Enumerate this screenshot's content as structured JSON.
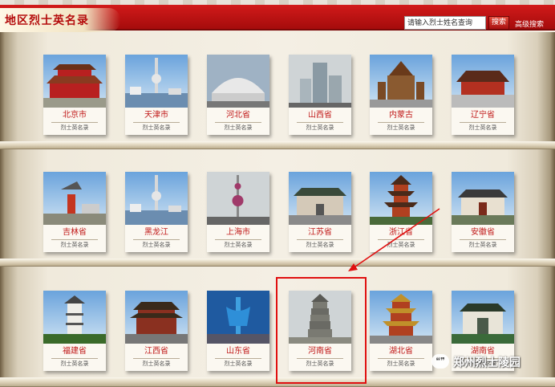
{
  "header": {
    "title": "地区烈士英名录",
    "search_placeholder": "请输入烈士姓名查询",
    "search_button": "搜索",
    "advanced_link": "高级搜索"
  },
  "card_subtitle": "烈士英名录",
  "shelves": [
    {
      "cards": [
        {
          "name": "北京市",
          "photo": "tiananmen"
        },
        {
          "name": "天津市",
          "photo": "tv-tower"
        },
        {
          "name": "河北省",
          "photo": "modern-building"
        },
        {
          "name": "山西省",
          "photo": "skyscraper"
        },
        {
          "name": "内蒙古",
          "photo": "domed-temple"
        },
        {
          "name": "辽宁省",
          "photo": "palace"
        }
      ]
    },
    {
      "cards": [
        {
          "name": "吉林省",
          "photo": "monument"
        },
        {
          "name": "黑龙江",
          "photo": "tv-tower"
        },
        {
          "name": "上海市",
          "photo": "pearl-tower"
        },
        {
          "name": "江苏省",
          "photo": "gate-building"
        },
        {
          "name": "浙江省",
          "photo": "pagoda"
        },
        {
          "name": "安徽省",
          "photo": "temple"
        }
      ]
    },
    {
      "cards": [
        {
          "name": "福建省",
          "photo": "white-pagoda"
        },
        {
          "name": "江西省",
          "photo": "pavilion"
        },
        {
          "name": "山东省",
          "photo": "fountain-sculpture"
        },
        {
          "name": "河南省",
          "photo": "stone-pagoda"
        },
        {
          "name": "湖北省",
          "photo": "yellow-crane-tower"
        },
        {
          "name": "湖南省",
          "photo": "gate-hall"
        }
      ]
    }
  ],
  "watermark": {
    "icon": "wechat-icon",
    "text": "郑州烈士陵园"
  },
  "colors": {
    "header_red": "#c41414",
    "label_red": "#c01818",
    "highlight": "#e01010"
  }
}
